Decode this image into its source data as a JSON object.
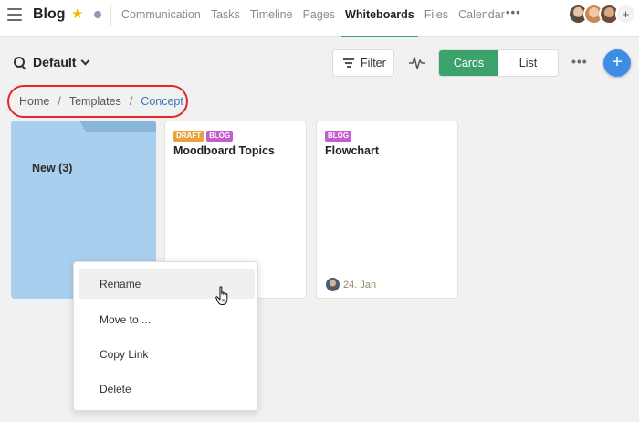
{
  "header": {
    "app_title": "Blog",
    "nav": [
      "Communication",
      "Tasks",
      "Timeline",
      "Pages",
      "Whiteboards",
      "Files",
      "Calendar"
    ],
    "active_nav": "Whiteboards",
    "more": "•••",
    "add_member": "+"
  },
  "toolbar": {
    "view_label": "Default",
    "filter_label": "Filter",
    "view_modes": [
      "Cards",
      "List"
    ],
    "active_view_mode": "Cards",
    "more": "•••",
    "add": "+"
  },
  "breadcrumb": {
    "items": [
      "Home",
      "Templates",
      "Concept"
    ],
    "separator": "/"
  },
  "folder": {
    "label": "New (3)"
  },
  "cards": [
    {
      "tags": [
        "DRAFT",
        "BLOG"
      ],
      "title": "Moodboard Topics",
      "date": ""
    },
    {
      "tags": [
        "BLOG"
      ],
      "title": "Flowchart",
      "date": "24. Jan"
    }
  ],
  "context_menu": {
    "items": [
      "Rename",
      "Move to ...",
      "Copy Link",
      "Delete"
    ],
    "hovered": "Rename"
  },
  "colors": {
    "accent_green": "#3aa26a",
    "add_button_blue": "#3d8de5",
    "folder_blue": "#a9cfee",
    "tag_draft": "#e8a23a",
    "tag_blog": "#c35dd0",
    "highlight_red": "#e5252a"
  }
}
